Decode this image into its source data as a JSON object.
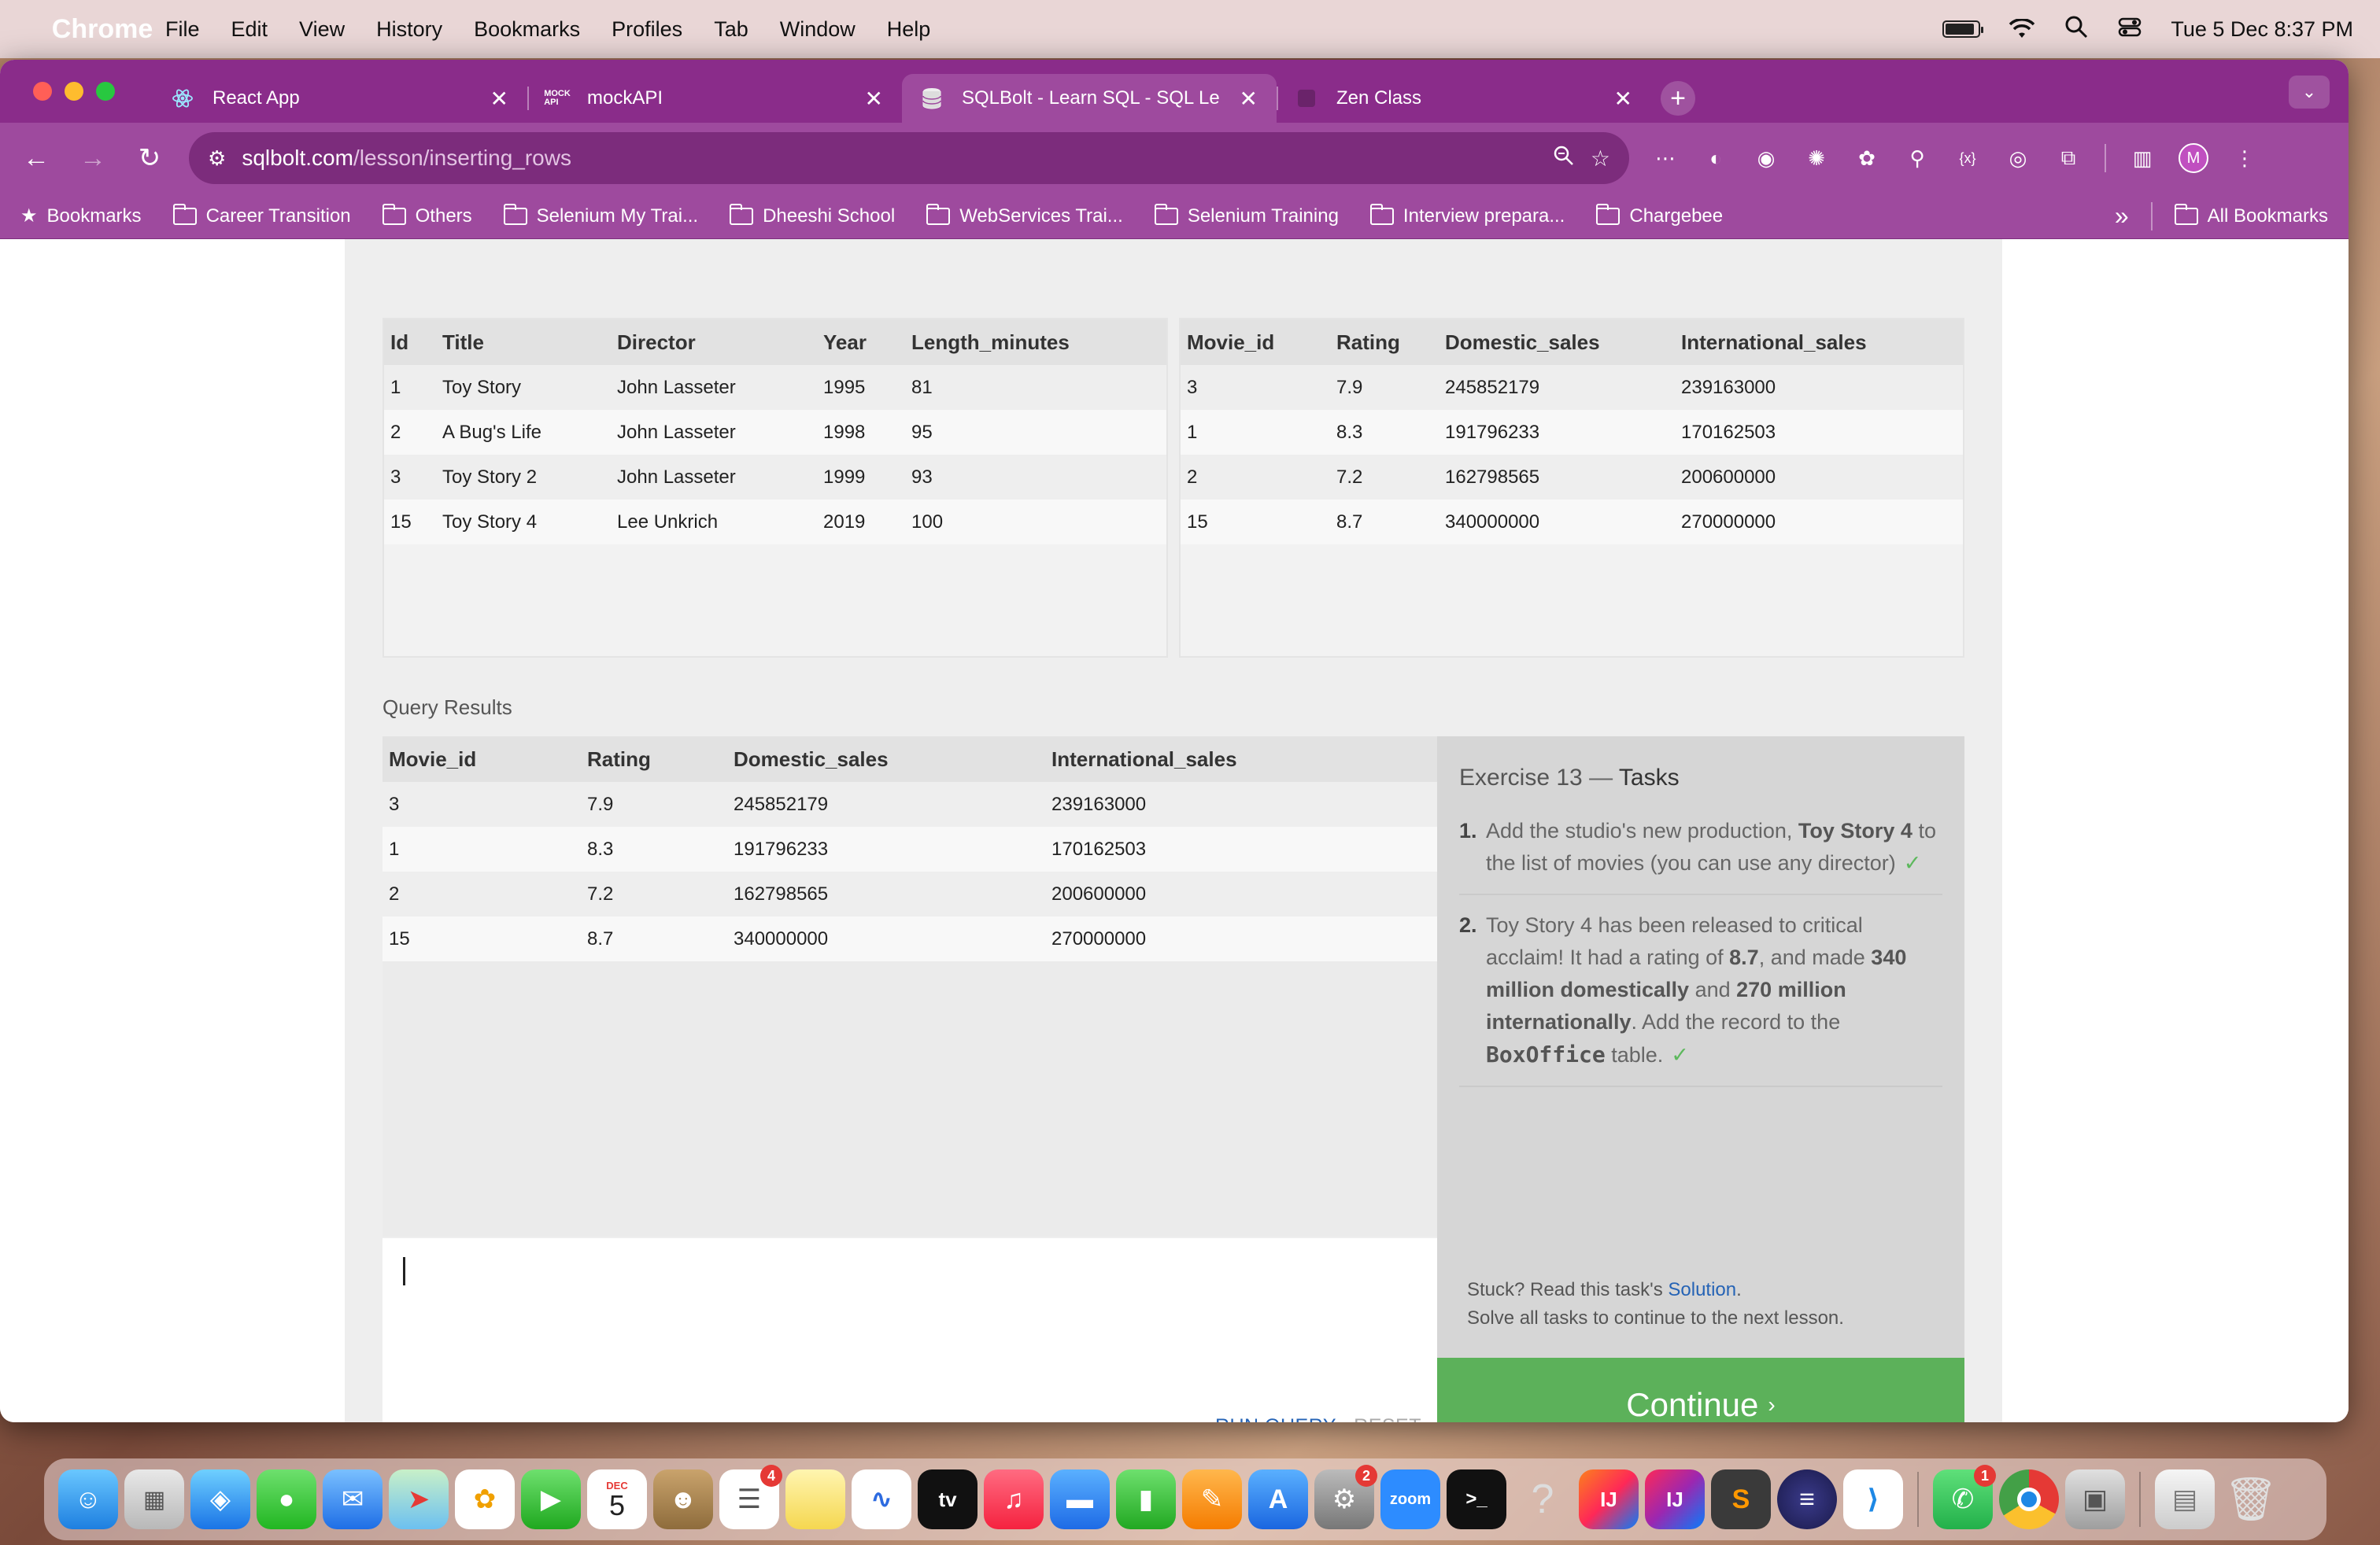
{
  "menubar": {
    "app": "Chrome",
    "items": [
      "File",
      "Edit",
      "View",
      "History",
      "Bookmarks",
      "Profiles",
      "Tab",
      "Window",
      "Help"
    ],
    "datetime": "Tue 5 Dec  8:37 PM"
  },
  "tabs": [
    {
      "title": "React App",
      "icon": "react-icon"
    },
    {
      "title": "mockAPI",
      "icon": "mockapi-icon"
    },
    {
      "title": "SQLBolt - Learn SQL - SQL Le",
      "icon": "database-icon",
      "active": true
    },
    {
      "title": "Zen Class",
      "icon": "zen-icon"
    }
  ],
  "omnibox": {
    "host": "sqlbolt.com",
    "path": "/lesson/inserting_rows"
  },
  "profile_initial": "M",
  "bookmarks": {
    "items": [
      "Bookmarks",
      "Career Transition",
      "Others",
      "Selenium My Trai...",
      "Dheeshi School",
      "WebServices Trai...",
      "Selenium Training",
      "Interview prepara...",
      "Chargebee"
    ],
    "overflow": "»",
    "all": "All Bookmarks"
  },
  "movies_table": {
    "headers": [
      "Id",
      "Title",
      "Director",
      "Year",
      "Length_minutes"
    ],
    "rows": [
      [
        "1",
        "Toy Story",
        "John Lasseter",
        "1995",
        "81"
      ],
      [
        "2",
        "A Bug's Life",
        "John Lasseter",
        "1998",
        "95"
      ],
      [
        "3",
        "Toy Story 2",
        "John Lasseter",
        "1999",
        "93"
      ],
      [
        "15",
        "Toy Story 4",
        "Lee Unkrich",
        "2019",
        "100"
      ]
    ]
  },
  "boxoffice_table": {
    "headers": [
      "Movie_id",
      "Rating",
      "Domestic_sales",
      "International_sales"
    ],
    "rows": [
      [
        "3",
        "7.9",
        "245852179",
        "239163000"
      ],
      [
        "1",
        "8.3",
        "191796233",
        "170162503"
      ],
      [
        "2",
        "7.2",
        "162798565",
        "200600000"
      ],
      [
        "15",
        "8.7",
        "340000000",
        "270000000"
      ]
    ]
  },
  "query_results": {
    "label": "Query Results",
    "headers": [
      "Movie_id",
      "Rating",
      "Domestic_sales",
      "International_sales"
    ],
    "rows": [
      [
        "3",
        "7.9",
        "245852179",
        "239163000"
      ],
      [
        "1",
        "8.3",
        "191796233",
        "170162503"
      ],
      [
        "2",
        "7.2",
        "162798565",
        "200600000"
      ],
      [
        "15",
        "8.7",
        "340000000",
        "270000000"
      ]
    ]
  },
  "editor": {
    "run_label": "RUN QUERY",
    "reset_label": "RESET"
  },
  "exercise": {
    "title_prefix": "Exercise 13",
    "title_sep": " — ",
    "title_suffix": "Tasks",
    "task1": {
      "num": "1.",
      "t1": "Add the studio's new production, ",
      "b1": "Toy Story 4",
      "t2": " to the list of movies (you can use any director)",
      "check": "✓"
    },
    "task2": {
      "num": "2.",
      "t1": "Toy Story 4 has been released to critical acclaim! It had a rating of ",
      "b1": "8.7",
      "t2": ", and made ",
      "b2": "340 million domestically",
      "t3": " and ",
      "b3": "270 million internationally",
      "t4": ". Add the record to the ",
      "code": "BoxOffice",
      "t5": " table.",
      "check": "✓"
    },
    "stuck_prefix": "Stuck? Read this task's ",
    "solution": "Solution",
    "stuck_suffix": ".",
    "solve_all": "Solve all tasks to continue to the next lesson.",
    "continue": "Continue",
    "continue_chev": "›"
  },
  "dock": {
    "calendar_month": "DEC",
    "calendar_day": "5",
    "reminders_badge": "4",
    "settings_badge": "2",
    "whatsapp_badge": "1",
    "zoom_label": "zoom",
    "tv_label": "tv"
  },
  "colors": {
    "browser_theme": "#9e4a9e",
    "continue_green": "#5cb15a",
    "link_blue": "#2563b5"
  }
}
